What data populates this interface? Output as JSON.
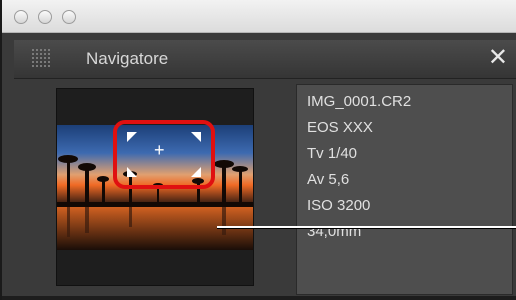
{
  "panel": {
    "title": "Navigatore",
    "close_icon": "close-icon",
    "grip_icon": "grip-icon"
  },
  "image_info": {
    "lines": [
      "IMG_0001.CR2",
      "EOS XXX",
      "Tv 1/40",
      "Av 5,6",
      "ISO 3200",
      "34,0mm"
    ]
  },
  "zoom_frame": {
    "center_icon": "crosshair-icon",
    "highlight_color": "#e01010"
  }
}
